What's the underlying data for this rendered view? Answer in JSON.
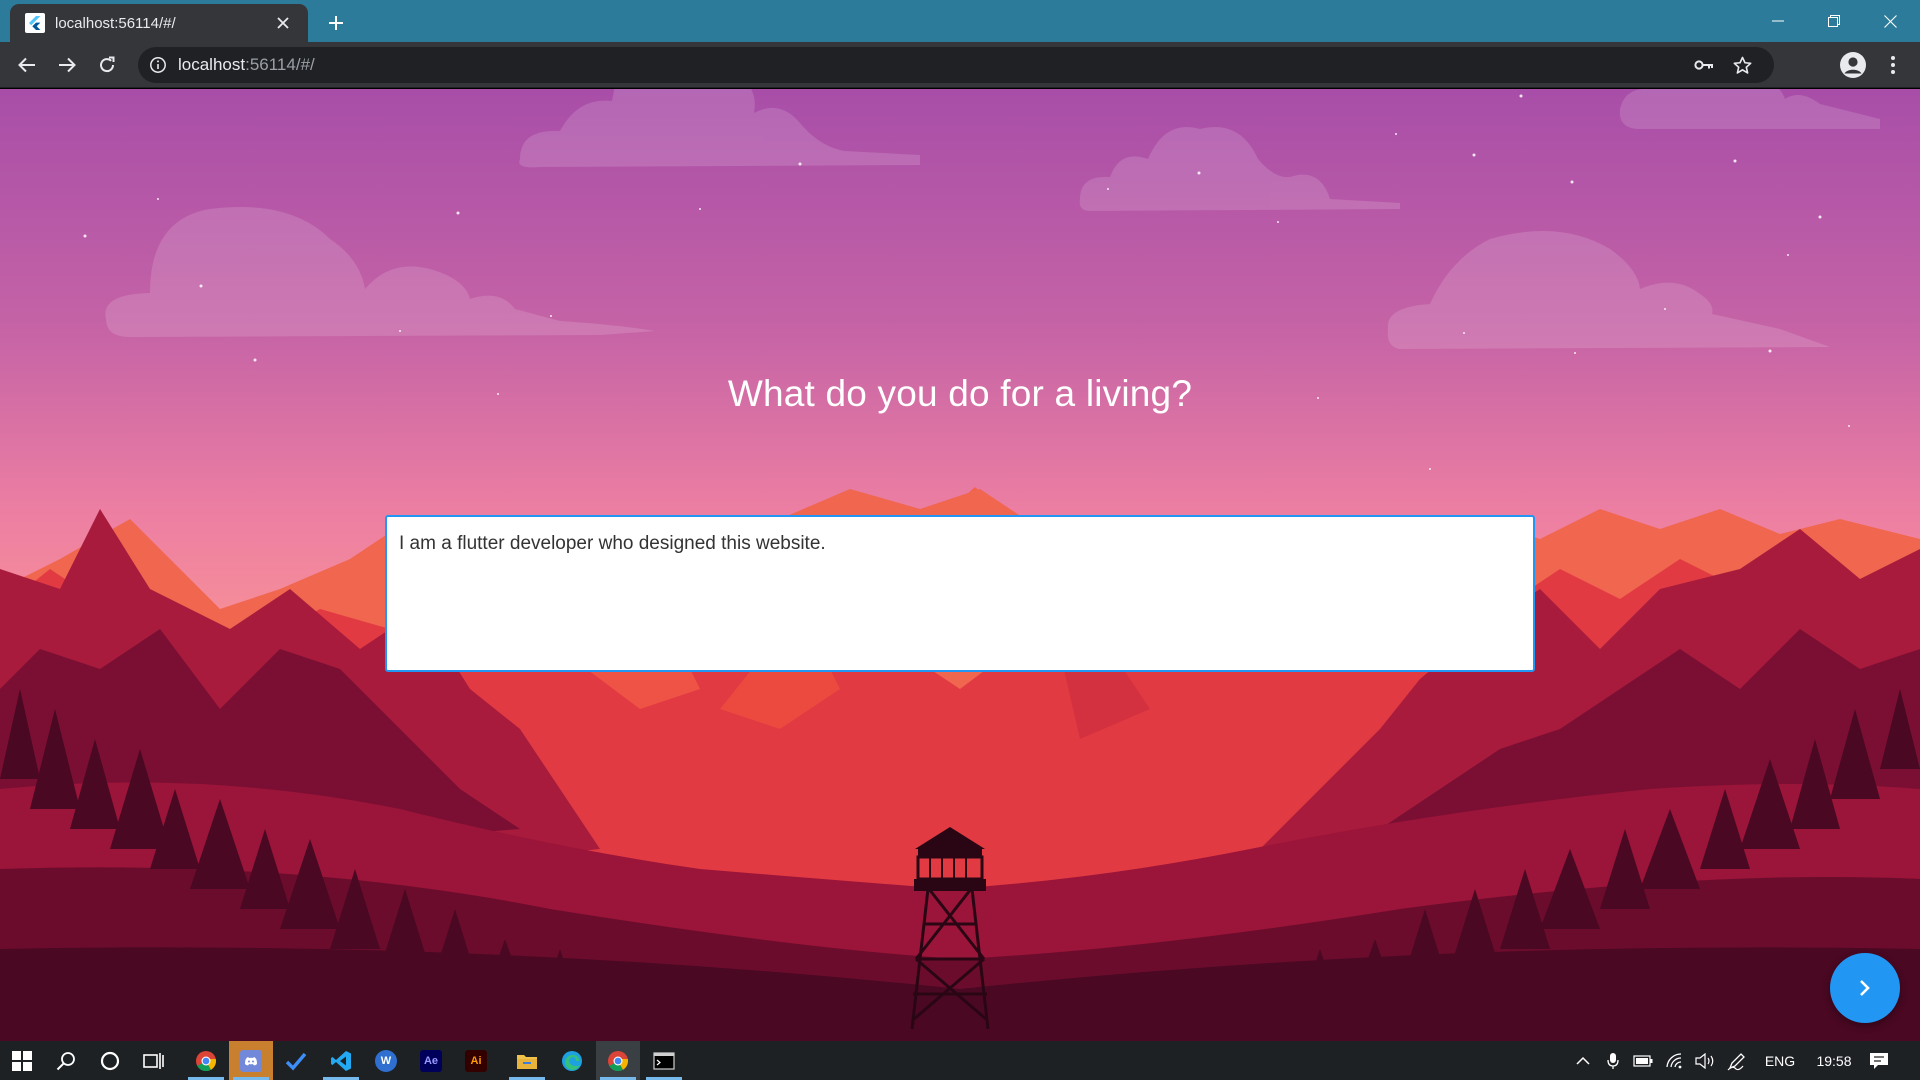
{
  "browser": {
    "tab_title": "localhost:56114/#/",
    "url_host": "localhost",
    "url_rest": ":56114/#/"
  },
  "page": {
    "question": "What do you do for a living?",
    "answer": "I am a flutter developer who designed this website."
  },
  "taskbar": {
    "apps": [
      {
        "name": "chrome",
        "icon": "chrome-icon"
      },
      {
        "name": "discord",
        "icon": "discord-icon"
      },
      {
        "name": "todo",
        "icon": "checkmark-icon"
      },
      {
        "name": "vscode",
        "icon": "vscode-icon"
      },
      {
        "name": "app-w",
        "icon": "w-app-icon"
      },
      {
        "name": "after-effects",
        "icon": "after-effects-icon",
        "label": "Ae"
      },
      {
        "name": "illustrator",
        "icon": "illustrator-icon",
        "label": "Ai"
      },
      {
        "name": "file-explorer",
        "icon": "folder-icon"
      },
      {
        "name": "edge",
        "icon": "edge-icon"
      },
      {
        "name": "chrome-active",
        "icon": "chrome-icon"
      },
      {
        "name": "terminal",
        "icon": "terminal-icon"
      }
    ],
    "language": "ENG",
    "time": "19:58"
  },
  "colors": {
    "accent": "#2196f3",
    "tab_strip": "#2c7b9a",
    "toolbar": "#35363a"
  }
}
